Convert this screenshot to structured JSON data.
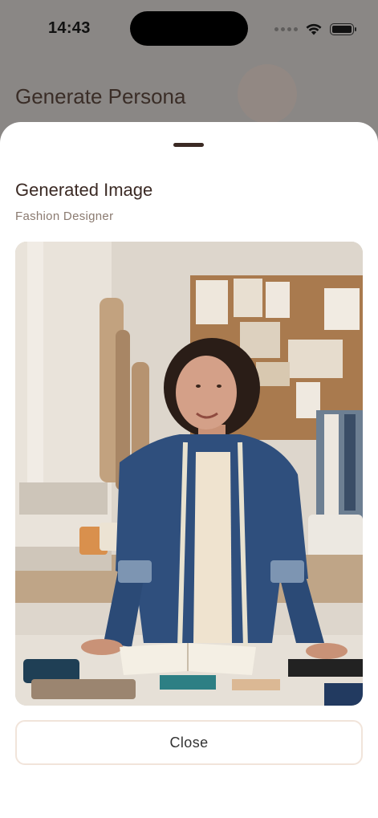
{
  "status_bar": {
    "time": "14:43"
  },
  "background_screen": {
    "title": "Generate Persona"
  },
  "sheet": {
    "title": "Generated Image",
    "subtitle": "Fashion Designer",
    "image_subject": "fashion-designer-portrait",
    "close_label": "Close"
  },
  "colors": {
    "sheet_bg": "#ffffff",
    "title_text": "#3b2a24",
    "subtitle_text": "#8a7a70",
    "button_border": "#f1e4da"
  }
}
